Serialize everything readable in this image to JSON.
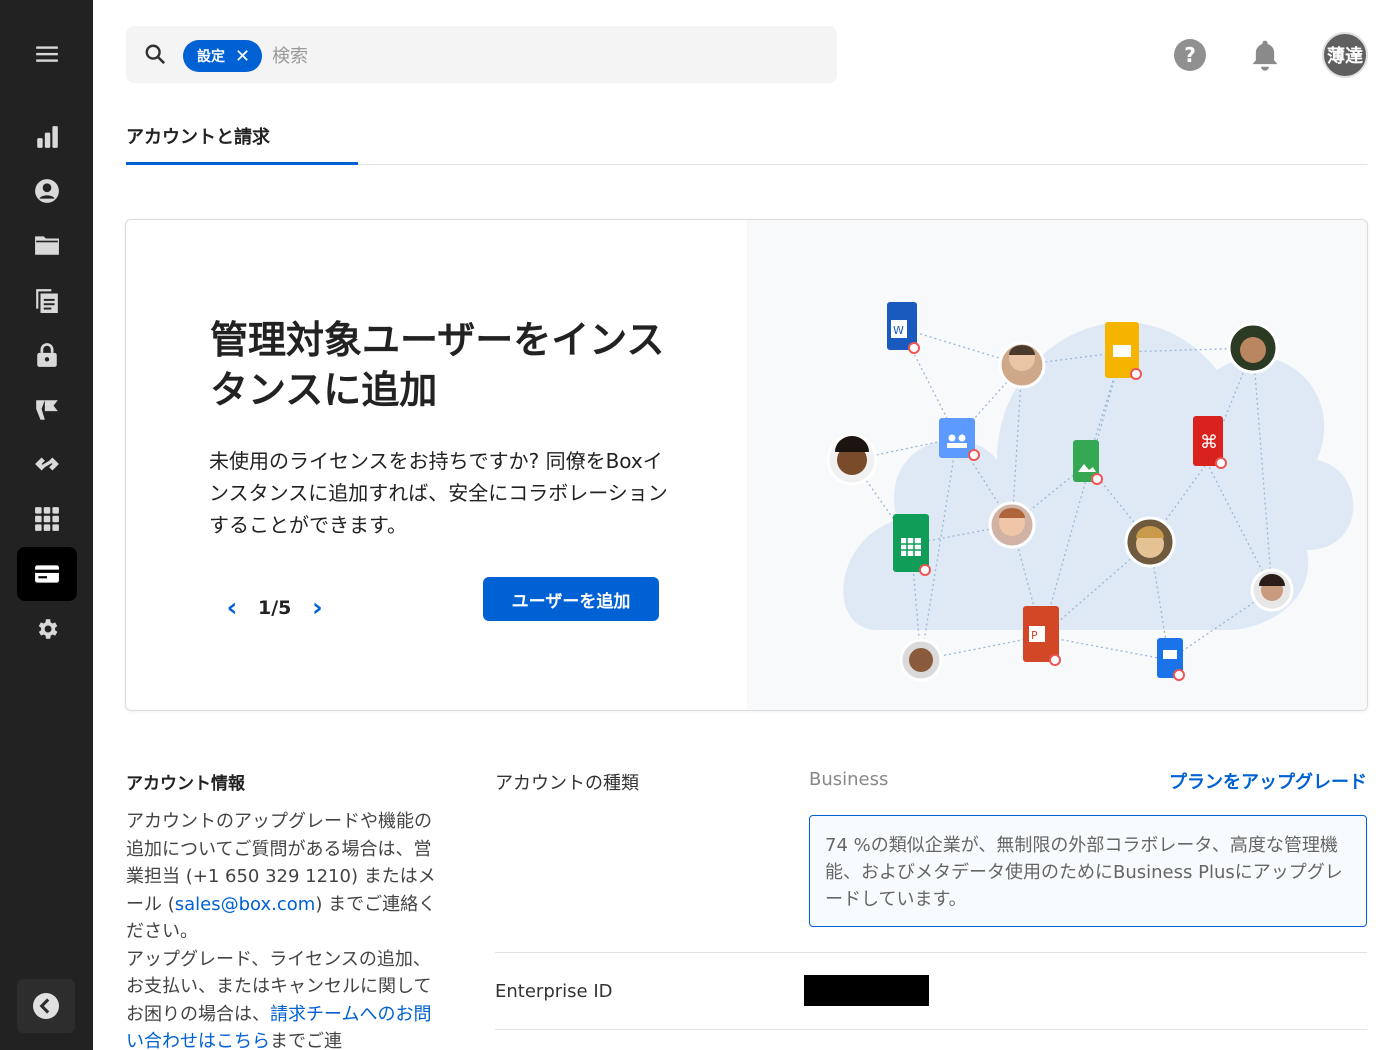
{
  "sidebar": {
    "items": [
      {
        "icon": "menu-icon"
      },
      {
        "icon": "reports-chart-icon"
      },
      {
        "icon": "users-icon"
      },
      {
        "icon": "folder-icon"
      },
      {
        "icon": "content-icon"
      },
      {
        "icon": "lock-icon"
      },
      {
        "icon": "governance-icon"
      },
      {
        "icon": "integrations-icon"
      },
      {
        "icon": "apps-grid-icon"
      },
      {
        "icon": "billing-card-icon",
        "active": true
      },
      {
        "icon": "gear-icon"
      }
    ],
    "collapse_icon": "chevron-left-icon"
  },
  "search": {
    "chip_label": "設定",
    "placeholder": "検索"
  },
  "header": {
    "help_label": "?",
    "avatar_initials": "薄達"
  },
  "tabs": [
    {
      "label": "アカウントと請求",
      "active": true
    }
  ],
  "promo": {
    "title": "管理対象ユーザーをインスタンスに追加",
    "description": "未使用のライセンスをお持ちですか? 同僚をBoxインスタンスに追加すれば、安全にコラボレーションすることができます。",
    "page_current": "1",
    "page_total": "5",
    "page_label": "1/5",
    "button_label": "ユーザーを追加"
  },
  "account_info": {
    "title": "アカウント情報",
    "text_1": "アカウントのアップグレードや機能の追加についてご質問がある場合は、営業担当 (+1 650 329 1210) またはメール (",
    "email": "sales@box.com",
    "text_2": ") までご連絡ください。",
    "text_3": "アップグレード、ライセンスの追加、お支払い、またはキャンセルに関してお困りの場合は、",
    "billing_link": "請求チームへのお問い合わせはこちら",
    "text_4": "までご連"
  },
  "account_type": {
    "label": "アカウントの種類",
    "value": "Business",
    "upgrade_link": "プランをアップグレード",
    "upsell_text": "74 %の類似企業が、無制限の外部コラボレータ、高度な管理機能、およびメタデータ使用のためにBusiness Plusにアップグレードしています。"
  },
  "enterprise": {
    "label": "Enterprise ID",
    "value_redacted": true
  },
  "colors": {
    "accent": "#0061d5",
    "sidebar_bg": "#222222"
  }
}
